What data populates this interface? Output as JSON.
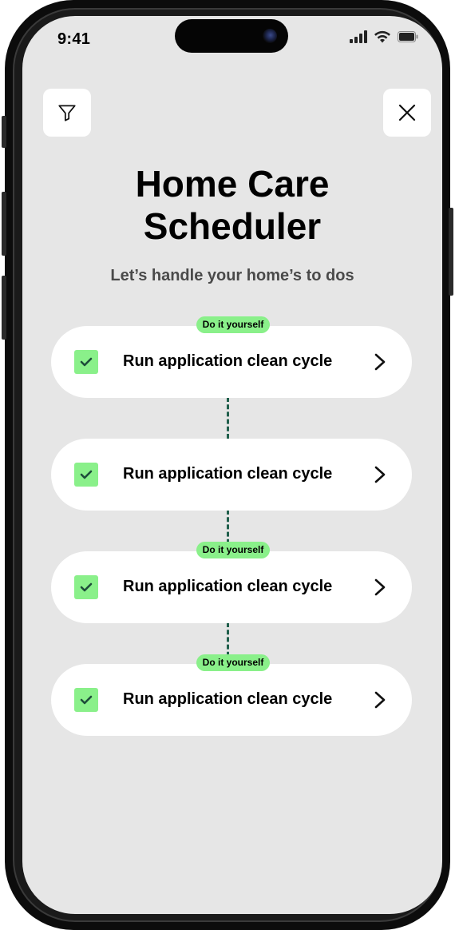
{
  "status_bar": {
    "time": "9:41",
    "icons": [
      "cellular-signal-icon",
      "wifi-icon",
      "battery-icon"
    ]
  },
  "toolbar": {
    "filter_icon": "filter-icon",
    "close_icon": "close-icon"
  },
  "header": {
    "title_line1": "Home Care",
    "title_line2": "Scheduler",
    "subtitle": "Let’s handle your home’s to dos"
  },
  "tasks": [
    {
      "label": "Run application clean cycle",
      "checked": true,
      "badge": "Do it yourself"
    },
    {
      "label": "Run application clean cycle",
      "checked": true,
      "badge": ""
    },
    {
      "label": "Run application clean cycle",
      "checked": true,
      "badge": "Do it yourself"
    },
    {
      "label": "Run application clean cycle",
      "checked": true,
      "badge": "Do it yourself"
    }
  ],
  "colors": {
    "screen_background": "#e6e6e6",
    "card_background": "#ffffff",
    "accent_green": "#8af08a",
    "connector_green": "#205f4c",
    "check_mark": "#1e4d3a"
  }
}
